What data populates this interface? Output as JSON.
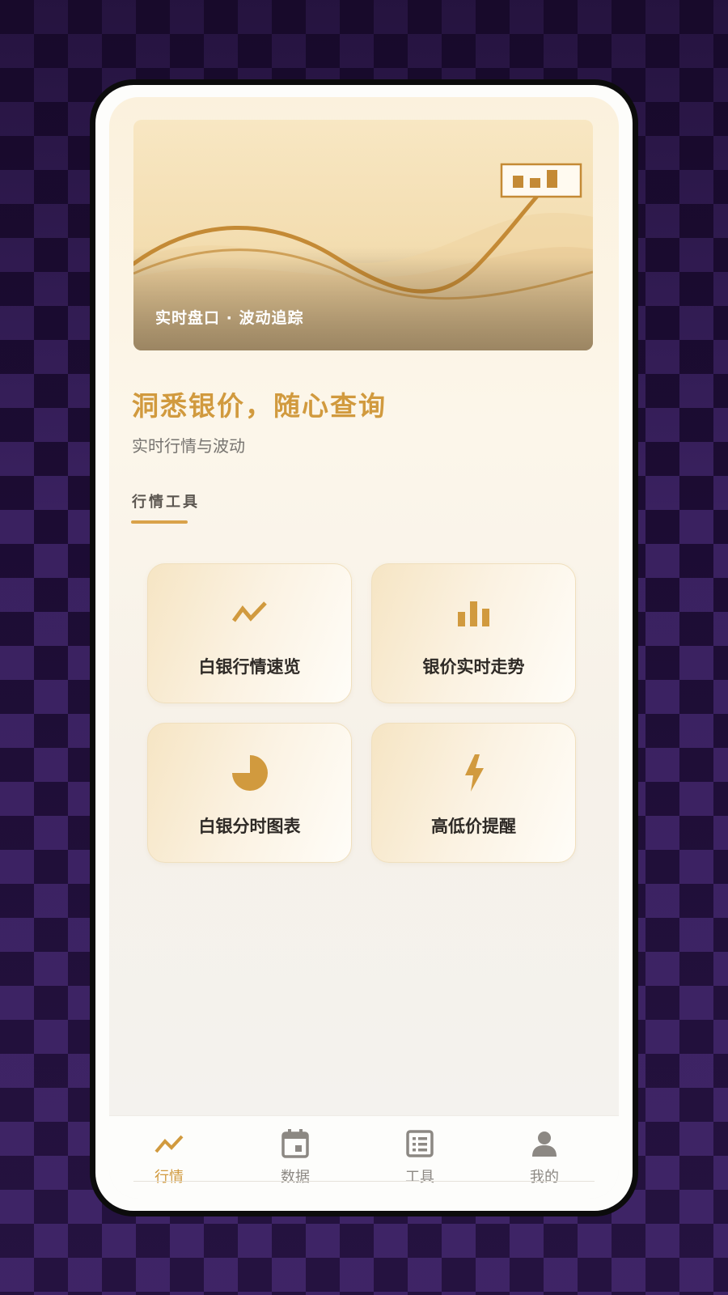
{
  "banner": {
    "caption": "实时盘口 · 波动追踪",
    "mini_chart_bars": [
      0.5,
      0.4,
      0.85
    ]
  },
  "hero": {
    "headline": "洞悉银价，随心查询",
    "subline": "实时行情与波动"
  },
  "section": {
    "title": "行情工具"
  },
  "cards": [
    {
      "label": "白银行情速览",
      "icon": "trend-line-icon"
    },
    {
      "label": "银价实时走势",
      "icon": "bar-chart-icon"
    },
    {
      "label": "白银分时图表",
      "icon": "pie-chart-icon"
    },
    {
      "label": "高低价提醒",
      "icon": "lightning-icon"
    }
  ],
  "bottom_nav": [
    {
      "label": "行情",
      "icon": "trend-icon",
      "active": true
    },
    {
      "label": "数据",
      "icon": "calendar-icon",
      "active": false
    },
    {
      "label": "工具",
      "icon": "list-icon",
      "active": false
    },
    {
      "label": "我的",
      "icon": "person-icon",
      "active": false
    }
  ],
  "colors": {
    "accent": "#d19a3e",
    "inactive": "#8c8883",
    "card_text": "#2e2a26"
  }
}
